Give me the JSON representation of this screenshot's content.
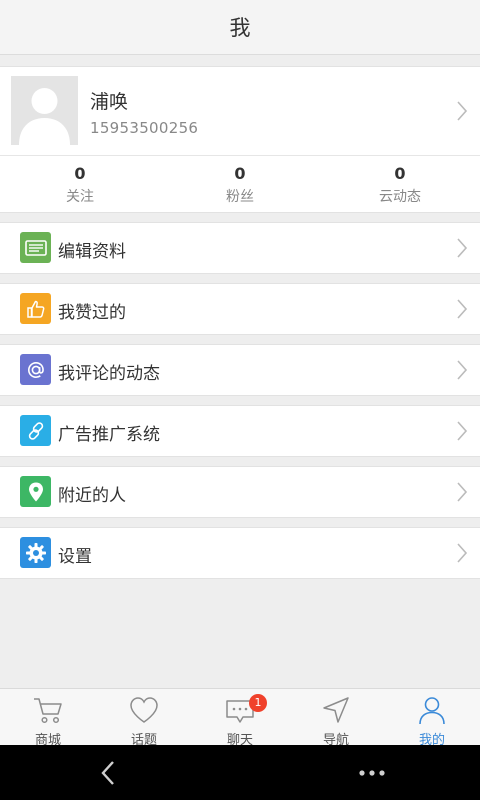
{
  "header": {
    "title": "我"
  },
  "profile": {
    "name": "浦唤",
    "phone": "15953500256",
    "stats": [
      {
        "value": "0",
        "label": "关注"
      },
      {
        "value": "0",
        "label": "粉丝"
      },
      {
        "value": "0",
        "label": "云动态"
      }
    ]
  },
  "menu": [
    {
      "label": "编辑资料",
      "icon": "id-card-icon",
      "color": "#6bb255"
    },
    {
      "label": "我赞过的",
      "icon": "thumbs-up-icon",
      "color": "#f5a623"
    },
    {
      "label": "我评论的动态",
      "icon": "at-icon",
      "color": "#6a73d0"
    },
    {
      "label": "广告推广系统",
      "icon": "link-icon",
      "color": "#2aaee6"
    },
    {
      "label": "附近的人",
      "icon": "location-pin-icon",
      "color": "#3db765"
    },
    {
      "label": "设置",
      "icon": "gear-icon",
      "color": "#2d8fe0"
    }
  ],
  "tabs": [
    {
      "label": "商城",
      "icon": "cart-icon"
    },
    {
      "label": "话题",
      "icon": "heart-icon"
    },
    {
      "label": "聊天",
      "icon": "chat-icon",
      "badge": "1"
    },
    {
      "label": "导航",
      "icon": "navigation-icon"
    },
    {
      "label": "我的",
      "icon": "person-icon",
      "active": true
    }
  ],
  "colors": {
    "accent": "#3b8ad8",
    "badge": "#f0412b"
  }
}
